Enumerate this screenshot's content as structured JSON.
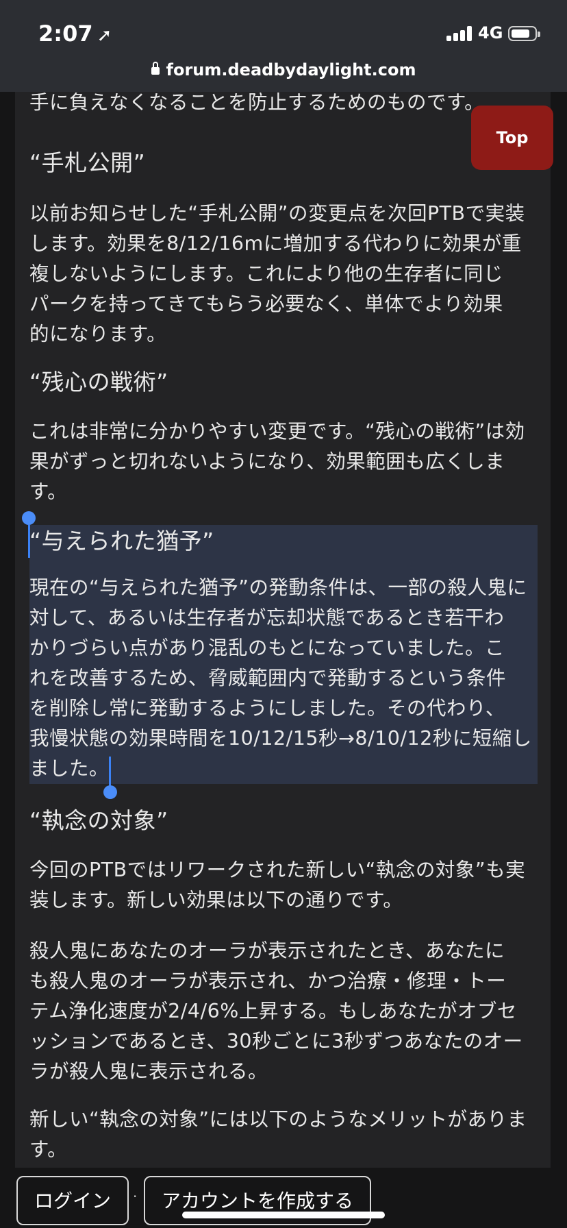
{
  "status": {
    "time": "2:07",
    "network": "4G",
    "url": "forum.deadbydaylight.com"
  },
  "top_button": "Top",
  "article": {
    "partial_line": "手に負えなくなることを防止するためのものです。",
    "sections": [
      {
        "heading": "“手札公開”",
        "paragraphs": [
          [
            "以前お知らせした“手札公開”の変更点を次回PTBで実装",
            "します。効果を8/12/16mに増加する代わりに効果が重",
            "複しないようにします。これにより他の生存者に同じ",
            "パークを持ってきてもらう必要なく、単体でより効果",
            "的になります。"
          ]
        ]
      },
      {
        "heading": "“残心の戦術”",
        "paragraphs": [
          [
            "これは非常に分かりやすい変更です。“残心の戦術”は効",
            "果がずっと切れないようになり、効果範囲も広くしま",
            "す。"
          ]
        ]
      },
      {
        "heading": "“与えられた猶予”",
        "paragraphs": [
          [
            "現在の“与えられた猶予”の発動条件は、一部の殺人鬼に",
            "対して、あるいは生存者が忘却状態であるとき若干わ",
            "かりづらい点があり混乱のもとになっていました。こ",
            "れを改善するため、脅威範囲内で発動するという条件",
            "を削除し常に発動するようにしました。その代わり、",
            "我慢状態の効果時間を10/12/15秒→8/10/12秒に短縮し",
            "ました。"
          ]
        ]
      },
      {
        "heading": "“執念の対象”",
        "paragraphs": [
          [
            "今回のPTBではリワークされた新しい“執念の対象”も実",
            "装します。新しい効果は以下の通りです。"
          ],
          [
            "殺人鬼にあなたのオーラが表示されたとき、あなたに",
            "も殺人鬼のオーラが表示され、かつ治療・修理・トー",
            "テム浄化速度が2/4/6%上昇する。もしあなたがオブセ",
            "ッションであるとき、30秒ごとに3秒ずつあなたのオー",
            "ラが殺人鬼に表示される。"
          ],
          [
            "新しい“執念の対象”には以下のようなメリットがありま",
            "す。"
          ]
        ]
      }
    ]
  },
  "footer": {
    "login": "ログイン",
    "separator": "·",
    "create_account": "アカウントを作成する"
  }
}
